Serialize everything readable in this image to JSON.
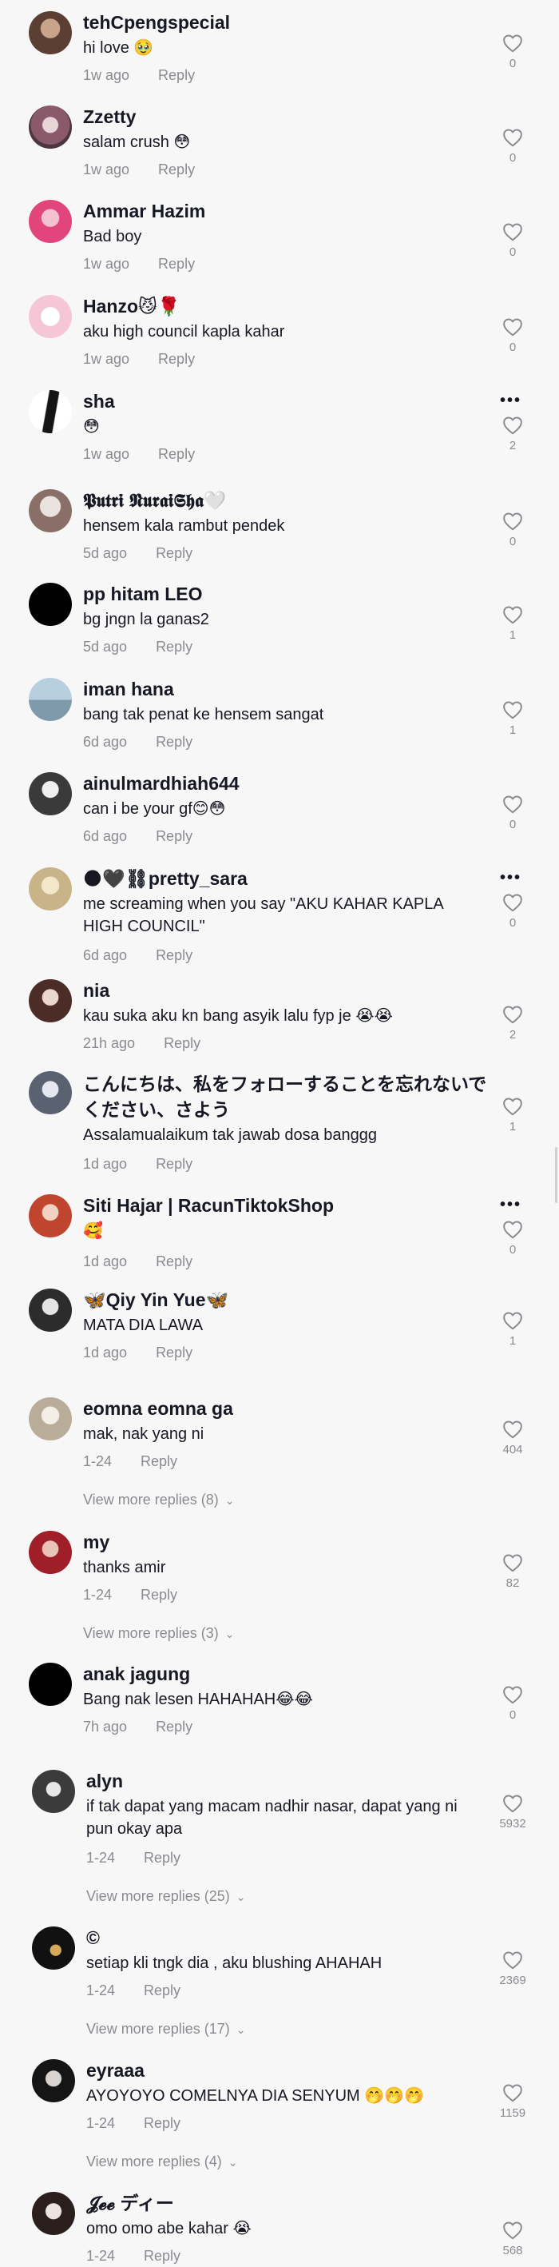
{
  "reply_label": "Reply",
  "comments": [
    {
      "name": "tehCpengspecial",
      "text": "hi love 🥹",
      "time": "1w ago",
      "likes": "0"
    },
    {
      "name": "Zzetty",
      "text": "salam crush 😳",
      "time": "1w ago",
      "likes": "0"
    },
    {
      "name": "Ammar Hazim",
      "text": "Bad boy",
      "time": "1w ago",
      "likes": "0"
    },
    {
      "name": "Hanzo😼🌹",
      "text": "aku high council kapla kahar",
      "time": "1w ago",
      "likes": "0"
    },
    {
      "name": "sha",
      "text": "😳",
      "time": "1w ago",
      "likes": "2"
    },
    {
      "name": "𝕻𝖚𝖙𝖗𝖎 𝕹𝖚𝖗𝖆𝖎𝕾𝖍𝖆🤍",
      "text": "hensem kala rambut pendek",
      "time": "5d ago",
      "likes": "0"
    },
    {
      "name": "pp hitam LEO",
      "text": "bg jngn la ganas2",
      "time": "5d ago",
      "likes": "1"
    },
    {
      "name": "iman hana",
      "text": "bang tak penat ke hensem sangat",
      "time": "6d ago",
      "likes": "1"
    },
    {
      "name": "ainulmardhiah644",
      "text": "can i be your gf😊😳",
      "time": "6d ago",
      "likes": "0"
    },
    {
      "name": "🌑🖤⛓pretty_sara",
      "text": "me screaming when you say \"AKU KAHAR KAPLA HIGH COUNCIL\"",
      "time": "6d ago",
      "likes": "0"
    },
    {
      "name": "nia",
      "text": "kau suka aku kn bang asyik lalu fyp je 😭😭",
      "time": "21h ago",
      "likes": "2"
    },
    {
      "name": "こんにちは、私をフォローすることを忘れないでください、さよう",
      "text": "Assalamualaikum tak jawab dosa banggg",
      "time": "1d ago",
      "likes": "1"
    },
    {
      "name": "Siti Hajar | RacunTiktokShop",
      "text": "🥰",
      "time": "1d ago",
      "likes": "0"
    },
    {
      "name": "🦋Qiy Yin Yue🦋",
      "text": "MATA DIA LAWA",
      "time": "1d ago",
      "likes": "1"
    },
    {
      "name": "eomna eomna ga",
      "text": "mak, nak yang ni",
      "time": "1-24",
      "likes": "404",
      "more": "View more replies (8)"
    },
    {
      "name": "my",
      "text": "thanks amir",
      "time": "1-24",
      "likes": "82",
      "more": "View more replies (3)"
    },
    {
      "name": "anak jagung",
      "text": "Bang nak lesen HAHAHAH😂😂",
      "time": "7h ago",
      "likes": "0"
    },
    {
      "name": "alyn",
      "text": "if tak dapat yang macam nadhir nasar, dapat yang ni pun okay apa",
      "time": "1-24",
      "likes": "5932",
      "more": "View more replies (25)"
    },
    {
      "name": "©",
      "text": "setiap kli tngk dia , aku blushing AHAHAH",
      "time": "1-24",
      "likes": "2369",
      "more": "View more replies (17)"
    },
    {
      "name": "eyraaa",
      "text": "AYOYOYO COMELNYA DIA SENYUM 🤭🤭🤭",
      "time": "1-24",
      "likes": "1159",
      "more": "View more replies (4)"
    },
    {
      "name": "𝓙𝓮𝓮 ディー",
      "text": "omo omo abe kahar 😭",
      "time": "1-24",
      "likes": "568"
    }
  ]
}
